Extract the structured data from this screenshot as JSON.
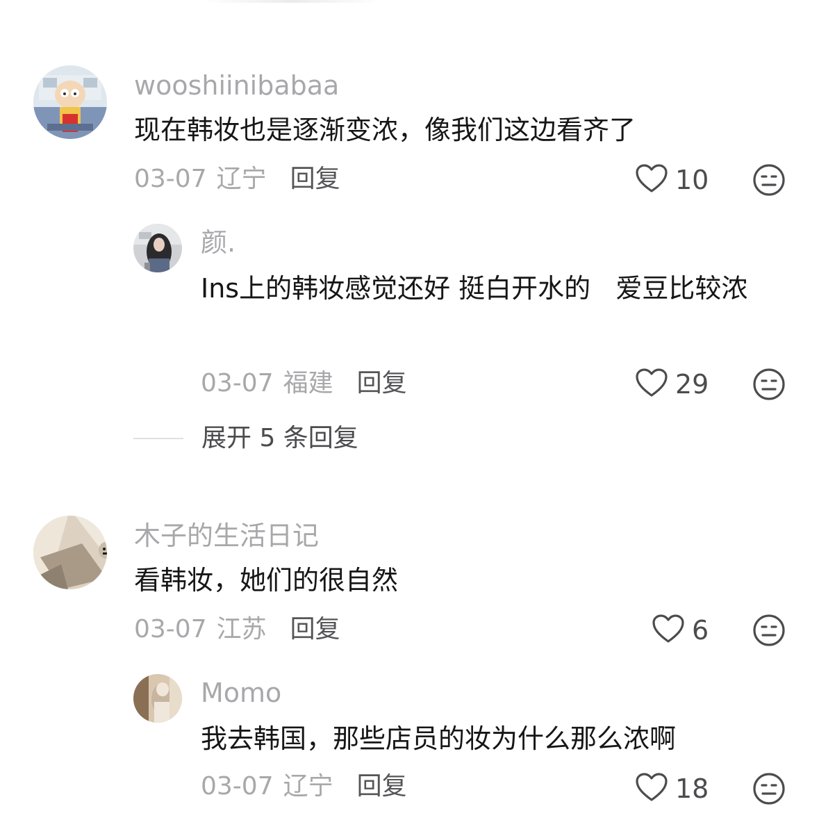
{
  "comments": [
    {
      "username": "wooshiinibabaa",
      "text": "现在韩妆也是逐渐变浓，像我们这边看齐了",
      "date": "03-07",
      "location": "辽宁",
      "reply_label": "回复",
      "likes": "10",
      "replies": [
        {
          "username": "颜.",
          "text": "Ins上的韩妆感觉还好 挺白开水的   爱豆比较浓",
          "date": "03-07",
          "location": "福建",
          "reply_label": "回复",
          "likes": "29"
        }
      ],
      "expand_label": "展开 5 条回复"
    },
    {
      "username": "木子的生活日记",
      "text": "看韩妆，她们的很自然",
      "date": "03-07",
      "location": "江苏",
      "reply_label": "回复",
      "likes": "6",
      "replies": [
        {
          "username": "Momo",
          "text": "我去韩国，那些店员的妆为什么那么浓啊",
          "date": "03-07",
          "location": "辽宁",
          "reply_label": "回复",
          "likes": "18"
        }
      ]
    }
  ],
  "icons": {
    "like": "heart-outline-icon",
    "dislike": "meh-face-icon"
  },
  "colors": {
    "username": "#a8a8ab",
    "text": "#161616",
    "meta": "#a8a8ab",
    "action": "#555558",
    "icon": "#4c4c4f"
  }
}
